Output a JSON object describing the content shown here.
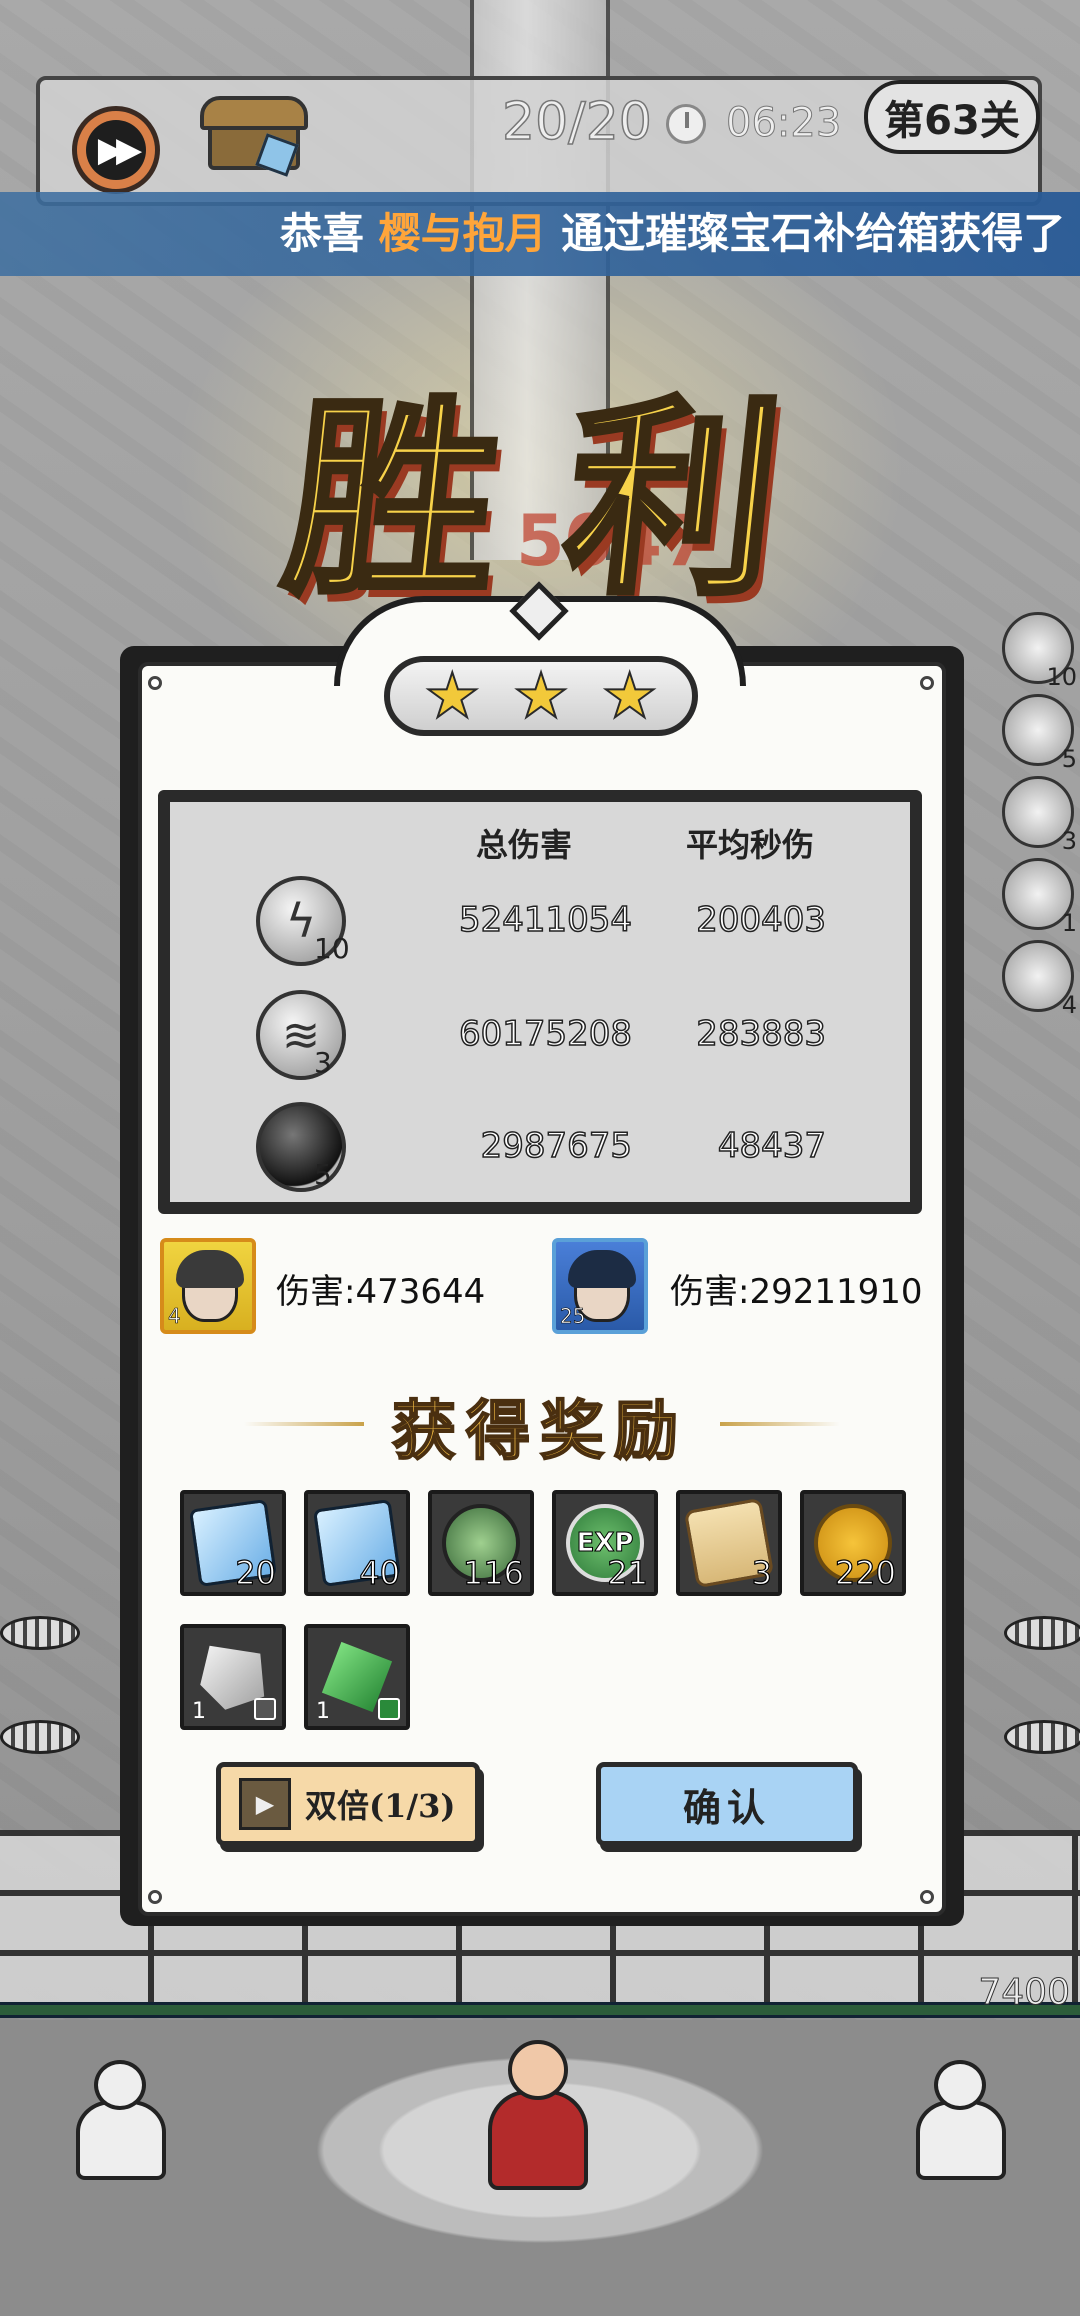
{
  "hud": {
    "wave": "20/20",
    "timer": "06:23",
    "level": "第63关",
    "hp": "7400"
  },
  "banner": {
    "prefix": "恭喜 ",
    "player": "樱与抱月",
    "suffix": " 通过璀璨宝石补给箱获得了"
  },
  "title": "胜利",
  "ghost_score": "5047",
  "stars": 3,
  "stats": {
    "col_damage": "总伤害",
    "col_dps": "平均秒伤",
    "rows": [
      {
        "icon": "lightning-skill-icon",
        "level": "10",
        "damage": "52411054",
        "dps": "200403"
      },
      {
        "icon": "tornado-skill-icon",
        "level": "3",
        "damage": "60175208",
        "dps": "283883"
      },
      {
        "icon": "bomb-skill-icon",
        "level": "5",
        "damage": "2987675",
        "dps": "48437"
      }
    ]
  },
  "heroes": [
    {
      "level": "4",
      "damage_label": "伤害:473644"
    },
    {
      "level": "25",
      "damage_label": "伤害:29211910"
    }
  ],
  "rewards": {
    "title": "获得奖励",
    "items": [
      {
        "icon": "tornado-gem-icon",
        "qty": "20"
      },
      {
        "icon": "lightning-gem-icon",
        "qty": "40"
      },
      {
        "icon": "plant-orb-icon",
        "qty": "116"
      },
      {
        "icon": "exp-orb-icon",
        "qty": "21",
        "label": "EXP"
      },
      {
        "icon": "scroll-icon",
        "qty": "3"
      },
      {
        "icon": "gold-coin-icon",
        "qty": "220"
      },
      {
        "icon": "stone-fragment-icon",
        "qty": "1"
      },
      {
        "icon": "emerald-fragment-icon",
        "qty": "1"
      }
    ]
  },
  "side_skills": [
    "10",
    "5",
    "3",
    "1",
    "4"
  ],
  "buttons": {
    "double": "双倍(1/3)",
    "confirm": "确认"
  },
  "colors": {
    "gold": "#f7d24a",
    "banner_highlight": "#ffa53a",
    "confirm_blue": "#a9d3f4",
    "double_cream": "#f6d9a8"
  }
}
